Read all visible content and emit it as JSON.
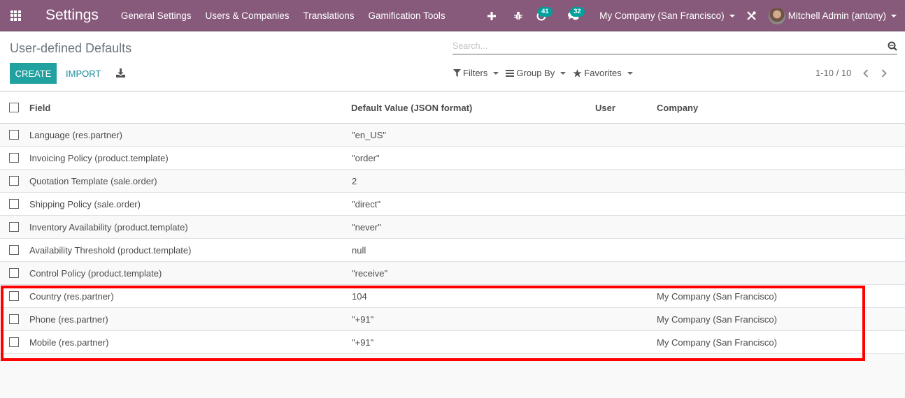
{
  "navbar": {
    "app_title": "Settings",
    "menu": [
      "General Settings",
      "Users & Companies",
      "Translations",
      "Gamification Tools"
    ],
    "activity_count": "41",
    "message_count": "32",
    "company": "My Company (San Francisco)",
    "user": "Mitchell Admin (antony)",
    "icons": [
      "apps-grid-icon",
      "plus-icon",
      "bug-icon",
      "clock-icon",
      "chat-icon",
      "tools-icon"
    ]
  },
  "control_panel": {
    "title": "User-defined Defaults",
    "search_placeholder": "Search...",
    "create_label": "CREATE",
    "import_label": "IMPORT",
    "filters_label": "Filters",
    "groupby_label": "Group By",
    "favorites_label": "Favorites",
    "pager": "1-10 / 10"
  },
  "table": {
    "headers": {
      "field": "Field",
      "value": "Default Value (JSON format)",
      "user": "User",
      "company": "Company"
    },
    "rows": [
      {
        "field": "Language (res.partner)",
        "value": "\"en_US\"",
        "user": "",
        "company": ""
      },
      {
        "field": "Invoicing Policy (product.template)",
        "value": "\"order\"",
        "user": "",
        "company": ""
      },
      {
        "field": "Quotation Template (sale.order)",
        "value": "2",
        "user": "",
        "company": ""
      },
      {
        "field": "Shipping Policy (sale.order)",
        "value": "\"direct\"",
        "user": "",
        "company": ""
      },
      {
        "field": "Inventory Availability (product.template)",
        "value": "\"never\"",
        "user": "",
        "company": ""
      },
      {
        "field": "Availability Threshold (product.template)",
        "value": "null",
        "user": "",
        "company": ""
      },
      {
        "field": "Control Policy (product.template)",
        "value": "\"receive\"",
        "user": "",
        "company": ""
      },
      {
        "field": "Country (res.partner)",
        "value": "104",
        "user": "",
        "company": "My Company (San Francisco)"
      },
      {
        "field": "Phone (res.partner)",
        "value": "\"+91\"",
        "user": "",
        "company": "My Company (San Francisco)"
      },
      {
        "field": "Mobile (res.partner)",
        "value": "\"+91\"",
        "user": "",
        "company": "My Company (San Francisco)"
      }
    ]
  },
  "colors": {
    "navbar": "#875a7b",
    "primary": "#21a19f",
    "badge": "#00a09d",
    "highlight": "#ff0000"
  }
}
